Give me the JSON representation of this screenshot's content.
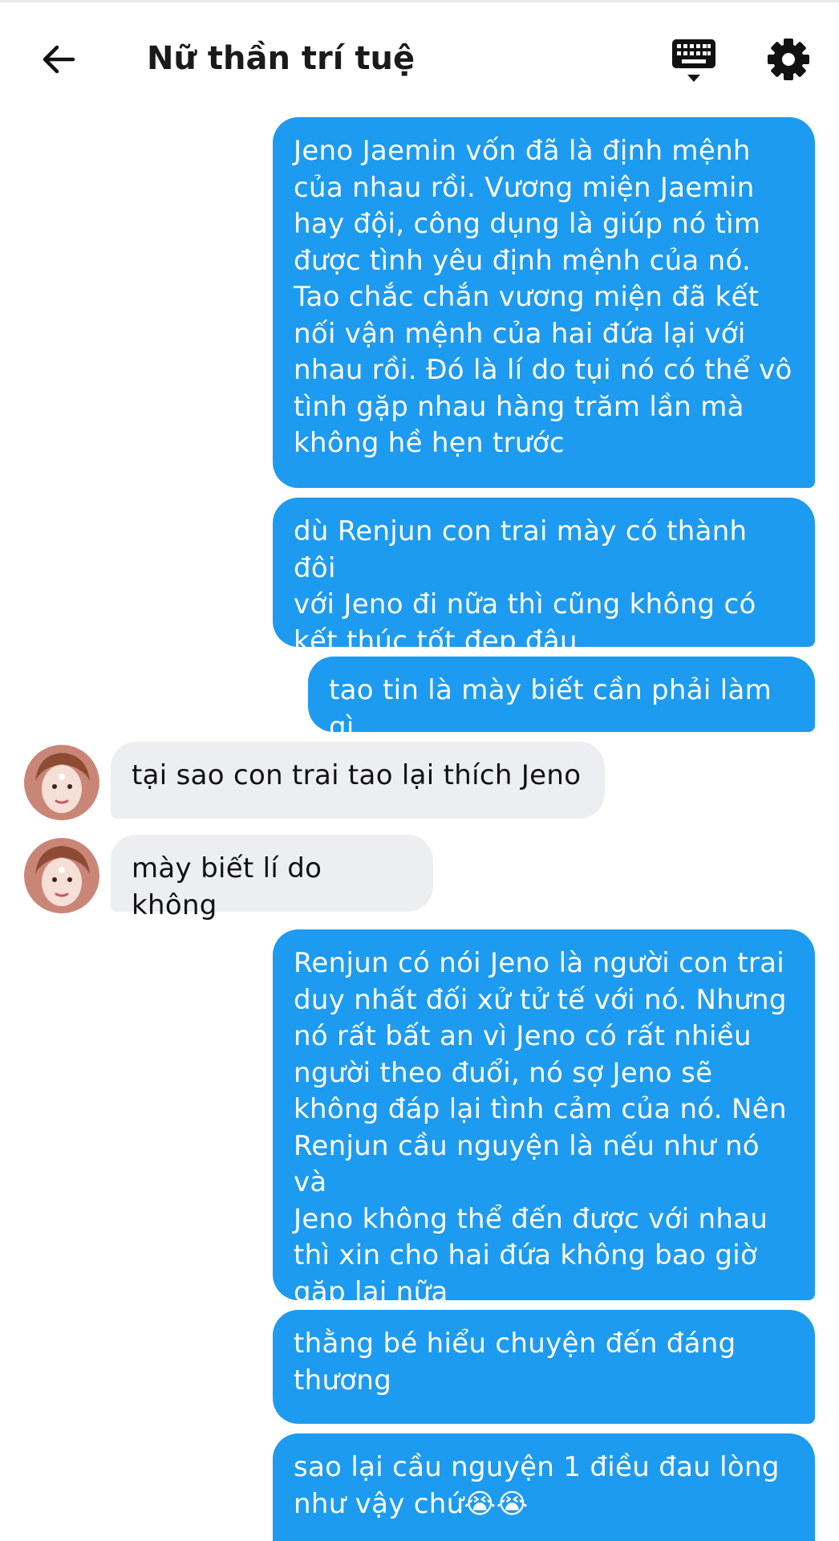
{
  "header": {
    "title": "Nữ thần trí tuệ",
    "back_icon": "arrow-left-icon",
    "keyboard_icon": "keyboard-icon",
    "settings_icon": "gear-icon"
  },
  "colors": {
    "outgoing_bubble": "#1d9bf0",
    "incoming_bubble": "#eceef1",
    "outgoing_text": "#ffffff",
    "incoming_text": "#111111"
  },
  "messages": [
    {
      "direction": "outgoing",
      "text": "Jeno Jaemin vốn đã là định mệnh\ncủa nhau rồi. Vương miện Jaemin\nhay đội, công dụng là giúp nó tìm\nđược tình yêu định mệnh của nó.\nTao chắc chắn vương miện đã kết\nnối vận mệnh của hai đứa lại với\nnhau rồi. Đó là lí do tụi nó có thể vô\ntình gặp nhau hàng trăm lần mà\nkhông hề hẹn trước"
    },
    {
      "direction": "outgoing",
      "text": "dù Renjun con trai mày có thành đôi\nvới Jeno đi nữa thì cũng không có\nkết thúc tốt đẹp đâu"
    },
    {
      "direction": "outgoing",
      "text": "tao tin là mày biết cần phải làm gì"
    },
    {
      "direction": "incoming",
      "text": "tại sao con trai tao lại thích Jeno"
    },
    {
      "direction": "incoming",
      "text": "mày biết lí do không"
    },
    {
      "direction": "outgoing",
      "text": "Renjun có nói Jeno là người con trai\nduy nhất đối xử tử tế với nó. Nhưng\nnó rất bất an vì Jeno có rất nhiều\nngười theo đuổi, nó sợ Jeno sẽ\nkhông đáp lại tình cảm của nó. Nên\nRenjun cầu nguyện là nếu như nó và\nJeno không thể đến được với nhau\nthì xin cho hai đứa không bao giờ\ngặp lại nữa"
    },
    {
      "direction": "outgoing",
      "text": "thằng bé hiểu chuyện đến đáng\nthương"
    },
    {
      "direction": "outgoing",
      "text": "sao lại cầu nguyện 1 điều đau lòng\nnhư vậy chứ😭😭"
    }
  ]
}
